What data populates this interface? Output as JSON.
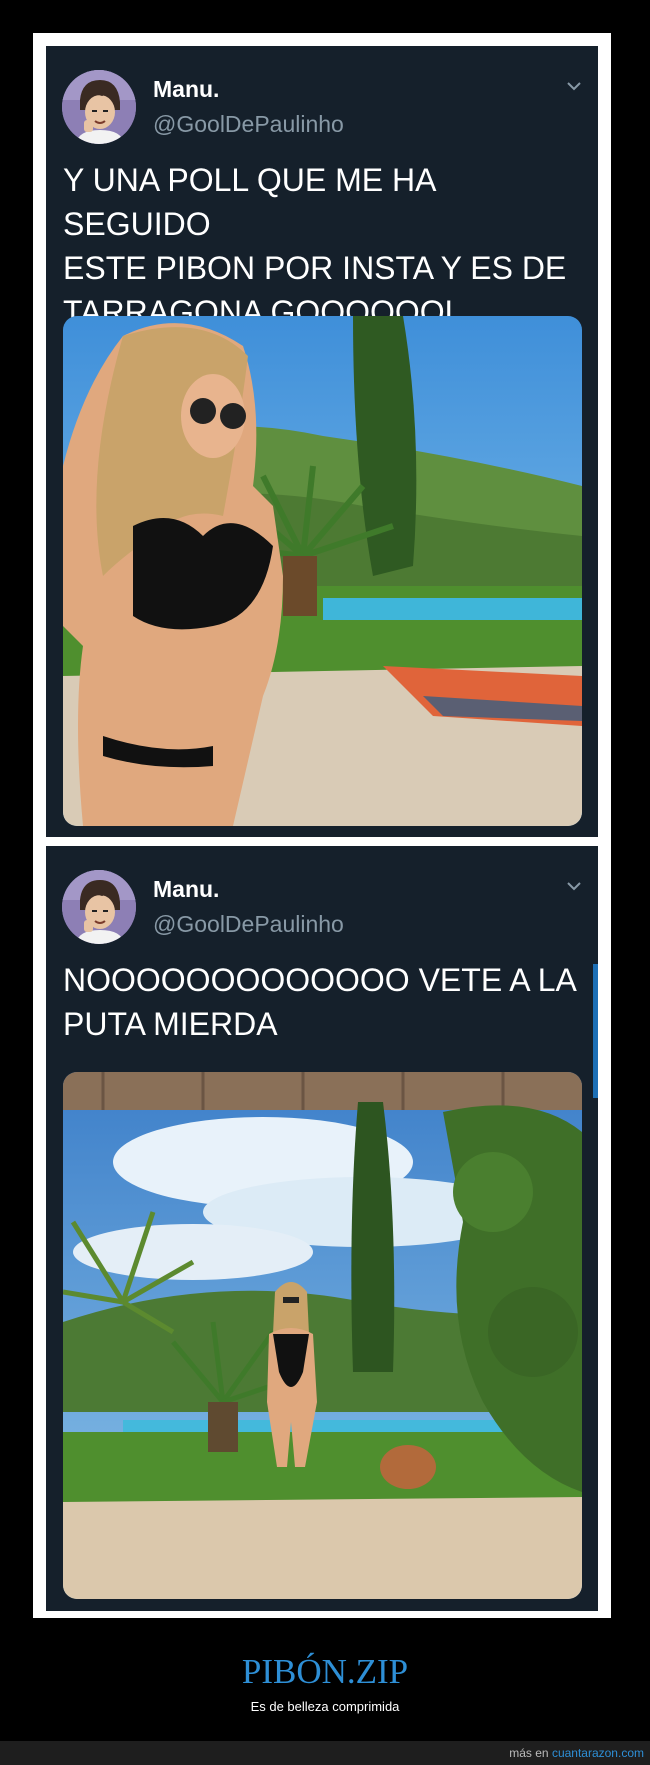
{
  "tweets": [
    {
      "name": "Manu.",
      "handle": "@GoolDePaulinho",
      "text_lines": [
        "Y UNA POLL QUE ME HA SEGUIDO",
        "ESTE PIBON POR INSTA Y ES DE",
        "TARRAGONA GOOOOOOL"
      ],
      "image": "bikini-selfie-garden-photo"
    },
    {
      "name": "Manu.",
      "handle": "@GoolDePaulinho",
      "text_lines": [
        "NOOOOOOOOOOOOO VETE A LA",
        "PUTA MIERDA"
      ],
      "image": "full-body-garden-photo"
    }
  ],
  "footer": {
    "title": "PIBÓN.ZIP",
    "subtitle": "Es de belleza comprimida"
  },
  "credit": {
    "prefix": "más en",
    "site": "cuantarazon.com"
  },
  "colors": {
    "tweet_bg": "#15202b",
    "handle": "#8899a6",
    "accent": "#2e8fd6"
  }
}
